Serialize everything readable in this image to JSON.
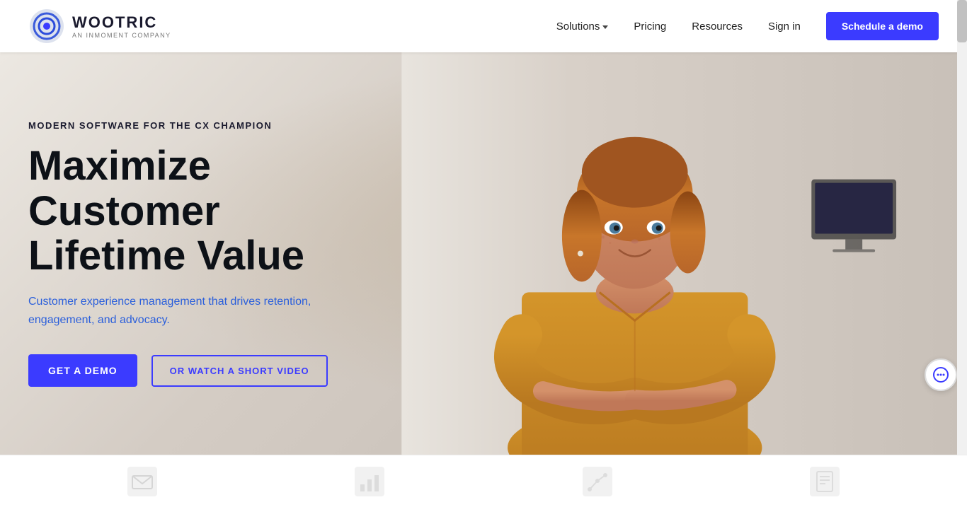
{
  "navbar": {
    "logo_main": "WOOTRIC",
    "logo_sub": "AN INMOMENT COMPANY",
    "nav_solutions": "Solutions",
    "nav_pricing": "Pricing",
    "nav_resources": "Resources",
    "nav_signin": "Sign in",
    "nav_cta": "Schedule a demo"
  },
  "hero": {
    "eyebrow": "MODERN SOFTWARE FOR THE CX CHAMPION",
    "title_line1": "Maximize",
    "title_line2": "Customer Lifetime Value",
    "description": "Customer experience management that drives retention, engagement, and advocacy.",
    "btn_demo": "GET A DEMO",
    "btn_video": "OR WATCH A SHORT VIDEO"
  },
  "footer": {
    "icons": [
      "envelope-icon",
      "chart-icon",
      "graph-icon",
      "document-icon"
    ]
  },
  "chat": {
    "label": "Chat widget"
  },
  "colors": {
    "accent": "#3b3bff",
    "dark": "#0d1117",
    "hero_bg": "#e8e4de"
  }
}
